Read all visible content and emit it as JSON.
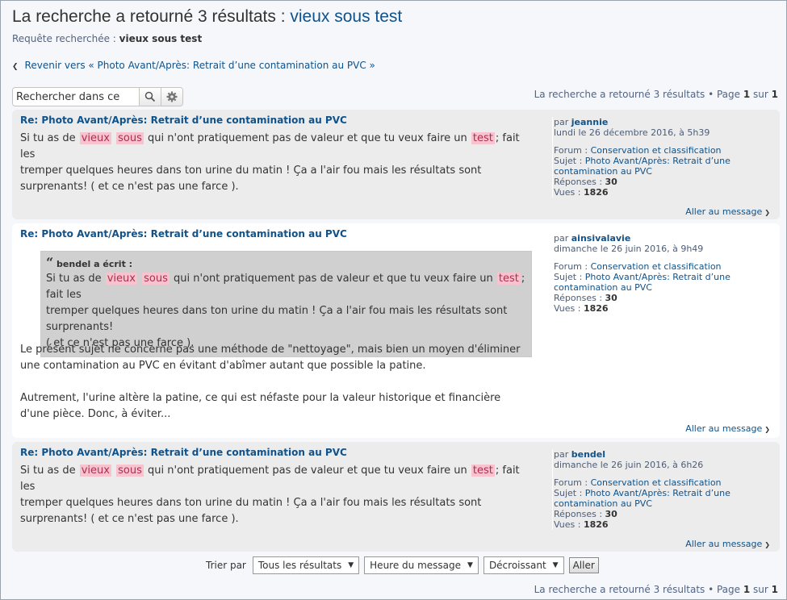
{
  "header": {
    "title_prefix": "La recherche a retourné 3 résultats : ",
    "title_keywords": "vieux sous test",
    "query_label": "Requête recherchée : ",
    "query_value": "vieux sous test",
    "back_link": "Revenir vers « Photo Avant/Après: Retrait d’une contamination au PVC »"
  },
  "search": {
    "value": "Rechercher dans ce",
    "search_icon": "search-icon",
    "advanced_icon": "gear-icon"
  },
  "pagination": {
    "text": "La recherche a retourné 3 résultats • Page ",
    "page": "1",
    "of": " sur ",
    "total": "1"
  },
  "results": [
    {
      "title": "Re: Photo Avant/Après: Retrait d’une contamination au PVC",
      "content": {
        "l1a": "Si tu as de",
        "kw1": "vieux",
        "kw2": "sous",
        "l1b": "qui n'ont pratiquement pas de valeur et que tu veux faire un",
        "kw3": "test",
        "l1c": "; fait les",
        "l2": "tremper quelques heures dans ton urine du matin ! Ça a l'air fou mais les résultats sont",
        "l3": "surprenants! ( et ce n'est pas une farce )."
      },
      "by": "par ",
      "author": "jeannie",
      "date": "lundi le 26 décembre 2016, à 5h39",
      "forum_label": "Forum : ",
      "forum": "Conservation et classification",
      "topic_label": "Sujet : ",
      "topic": "Photo Avant/Après: Retrait d’une contamination au PVC",
      "replies_label": "Réponses : ",
      "replies": "30",
      "views_label": "Vues : ",
      "views": "1826",
      "jump": "Aller au message"
    },
    {
      "title": "Re: Photo Avant/Après: Retrait d’une contamination au PVC",
      "quote": {
        "cite": "bendel a écrit :",
        "l1a": "Si tu as de",
        "kw1": "vieux",
        "kw2": "sous",
        "l1b": "qui n'ont pratiquement pas de valeur et que tu veux faire un",
        "kw3": "test",
        "l1c": "; fait les",
        "l2": "tremper quelques heures dans ton urine du matin ! Ça a l'air fou mais les résultats sont surprenants!",
        "l3": "( et ce n'est pas une farce )."
      },
      "p1": "Le présent sujet ne concerne pas une méthode de \"nettoyage\", mais bien un moyen d'éliminer une contamination au PVC en évitant d'abîmer autant que possible la patine.",
      "p2": "Autrement, l'urine altère la patine, ce qui est néfaste pour la valeur historique et financière d'une pièce. Donc, à éviter...",
      "by": "par ",
      "author": "ainsivalavie",
      "date": "dimanche le 26 juin 2016, à 9h49",
      "forum_label": "Forum : ",
      "forum": "Conservation et classification",
      "topic_label": "Sujet : ",
      "topic": "Photo Avant/Après: Retrait d’une contamination au PVC",
      "replies_label": "Réponses : ",
      "replies": "30",
      "views_label": "Vues : ",
      "views": "1826",
      "jump": "Aller au message"
    },
    {
      "title": "Re: Photo Avant/Après: Retrait d’une contamination au PVC",
      "content": {
        "l1a": "Si tu as de",
        "kw1": "vieux",
        "kw2": "sous",
        "l1b": "qui n'ont pratiquement pas de valeur et que tu veux faire un",
        "kw3": "test",
        "l1c": "; fait les",
        "l2": "tremper quelques heures dans ton urine du matin ! Ça a l'air fou mais les résultats sont",
        "l3": "surprenants! ( et ce n'est pas une farce )."
      },
      "by": "par ",
      "author": "bendel",
      "date": "dimanche le 26 juin 2016, à 6h26",
      "forum_label": "Forum : ",
      "forum": "Conservation et classification",
      "topic_label": "Sujet : ",
      "topic": "Photo Avant/Après: Retrait d’une contamination au PVC",
      "replies_label": "Réponses : ",
      "replies": "30",
      "views_label": "Vues : ",
      "views": "1826",
      "jump": "Aller au message"
    }
  ],
  "sort": {
    "label": "Trier par",
    "scope": "Tous les résultats",
    "key": "Heure du message",
    "direction": "Décroissant",
    "go": "Aller"
  },
  "colors": {
    "link": "#105289",
    "highlight": "#f6c3cf",
    "row_alt": "#ececec"
  }
}
